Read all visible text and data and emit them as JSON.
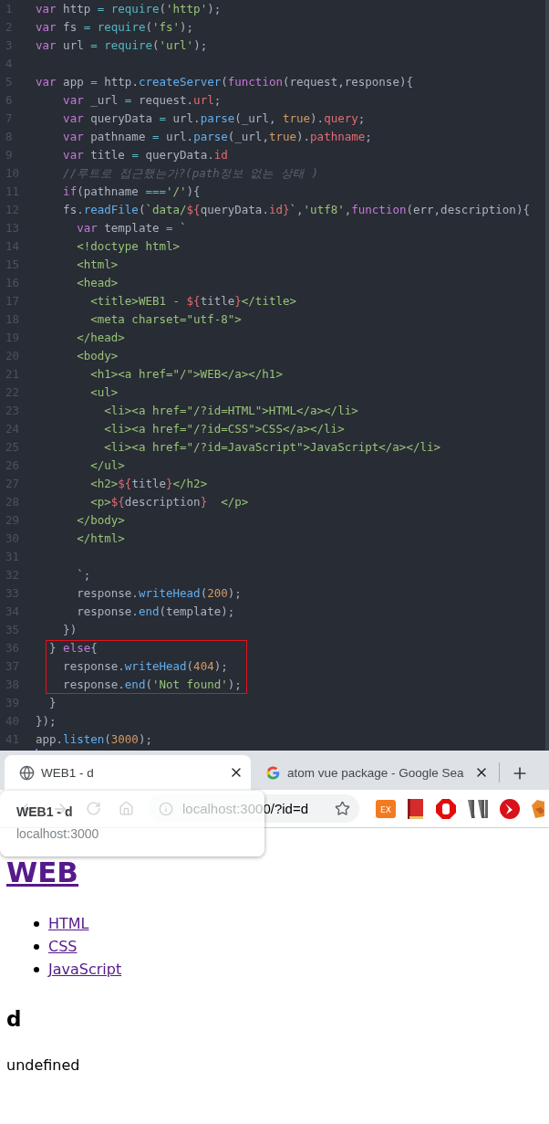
{
  "editor": {
    "lines": [
      {
        "number": "1",
        "boxed": false,
        "tokens": [
          {
            "kind": "k",
            "text": "var"
          },
          {
            "kind": "t",
            "text": " http "
          },
          {
            "kind": "o",
            "text": "= "
          },
          {
            "kind": "b",
            "text": "require"
          },
          {
            "kind": "t",
            "text": "("
          },
          {
            "kind": "s",
            "text": "'http'"
          },
          {
            "kind": "t",
            "text": ");"
          }
        ]
      },
      {
        "number": "2",
        "boxed": false,
        "tokens": [
          {
            "kind": "k",
            "text": "var"
          },
          {
            "kind": "t",
            "text": " fs "
          },
          {
            "kind": "o",
            "text": "= "
          },
          {
            "kind": "b",
            "text": "require"
          },
          {
            "kind": "t",
            "text": "("
          },
          {
            "kind": "s",
            "text": "'fs'"
          },
          {
            "kind": "t",
            "text": ");"
          }
        ]
      },
      {
        "number": "3",
        "boxed": false,
        "tokens": [
          {
            "kind": "k",
            "text": "var"
          },
          {
            "kind": "t",
            "text": " url "
          },
          {
            "kind": "o",
            "text": "= "
          },
          {
            "kind": "b",
            "text": "require"
          },
          {
            "kind": "t",
            "text": "("
          },
          {
            "kind": "s",
            "text": "'url'"
          },
          {
            "kind": "t",
            "text": ");"
          }
        ]
      },
      {
        "number": "4",
        "boxed": false
      },
      {
        "number": "5",
        "boxed": false,
        "tokens": [
          {
            "kind": "k",
            "text": "var"
          },
          {
            "kind": "t",
            "text": " app "
          },
          {
            "kind": "o",
            "text": "="
          },
          {
            "kind": "t",
            "text": " http."
          },
          {
            "kind": "f",
            "text": "createServer"
          },
          {
            "kind": "t",
            "text": "("
          },
          {
            "kind": "k",
            "text": "function"
          },
          {
            "kind": "t",
            "text": "(request,response){"
          }
        ]
      },
      {
        "number": "6",
        "boxed": false,
        "tokens": [
          {
            "kind": "k",
            "text": "    var"
          },
          {
            "kind": "t",
            "text": " _url "
          },
          {
            "kind": "o",
            "text": "="
          },
          {
            "kind": "t",
            "text": " request."
          },
          {
            "kind": "p",
            "text": "url"
          },
          {
            "kind": "t",
            "text": ";"
          }
        ]
      },
      {
        "number": "7",
        "boxed": false,
        "tokens": [
          {
            "kind": "k",
            "text": "    var"
          },
          {
            "kind": "t",
            "text": " queryData "
          },
          {
            "kind": "o",
            "text": "="
          },
          {
            "kind": "t",
            "text": " url."
          },
          {
            "kind": "f",
            "text": "parse"
          },
          {
            "kind": "t",
            "text": "(_url, "
          },
          {
            "kind": "n",
            "text": "true"
          },
          {
            "kind": "t",
            "text": ")."
          },
          {
            "kind": "p",
            "text": "query"
          },
          {
            "kind": "t",
            "text": ";"
          }
        ]
      },
      {
        "number": "8",
        "boxed": false,
        "tokens": [
          {
            "kind": "k",
            "text": "    var"
          },
          {
            "kind": "t",
            "text": " pathname "
          },
          {
            "kind": "o",
            "text": "="
          },
          {
            "kind": "t",
            "text": " url."
          },
          {
            "kind": "f",
            "text": "parse"
          },
          {
            "kind": "t",
            "text": "(_url,"
          },
          {
            "kind": "n",
            "text": "true"
          },
          {
            "kind": "t",
            "text": ")."
          },
          {
            "kind": "p",
            "text": "pathname"
          },
          {
            "kind": "t",
            "text": ";"
          }
        ]
      },
      {
        "number": "9",
        "boxed": false,
        "tokens": [
          {
            "kind": "k",
            "text": "    var"
          },
          {
            "kind": "t",
            "text": " title "
          },
          {
            "kind": "o",
            "text": "="
          },
          {
            "kind": "t",
            "text": " queryData."
          },
          {
            "kind": "p",
            "text": "id"
          }
        ]
      },
      {
        "number": "10",
        "boxed": false,
        "tokens": [
          {
            "kind": "c",
            "text": "    //루트로 접근했는가?(path정보 없는 상태 )"
          }
        ]
      },
      {
        "number": "11",
        "boxed": false,
        "tokens": [
          {
            "kind": "k",
            "text": "    if"
          },
          {
            "kind": "t",
            "text": "(pathname "
          },
          {
            "kind": "o",
            "text": "==="
          },
          {
            "kind": "s",
            "text": "'/'"
          },
          {
            "kind": "t",
            "text": "){"
          }
        ]
      },
      {
        "number": "12",
        "boxed": false,
        "tokens": [
          {
            "kind": "t",
            "text": "    fs."
          },
          {
            "kind": "f",
            "text": "readFile"
          },
          {
            "kind": "t",
            "text": "("
          },
          {
            "kind": "s",
            "text": "`data/"
          },
          {
            "kind": "p",
            "text": "${"
          },
          {
            "kind": "t",
            "text": "queryData."
          },
          {
            "kind": "p",
            "text": "id"
          },
          {
            "kind": "p",
            "text": "}"
          },
          {
            "kind": "s",
            "text": "`"
          },
          {
            "kind": "t",
            "text": ","
          },
          {
            "kind": "s",
            "text": "'utf8'"
          },
          {
            "kind": "t",
            "text": ","
          },
          {
            "kind": "k",
            "text": "function"
          },
          {
            "kind": "t",
            "text": "(err,description){"
          }
        ]
      },
      {
        "number": "13",
        "boxed": false,
        "tokens": [
          {
            "kind": "k",
            "text": "      var"
          },
          {
            "kind": "t",
            "text": " template "
          },
          {
            "kind": "o",
            "text": "="
          },
          {
            "kind": "s",
            "text": " `"
          }
        ]
      },
      {
        "number": "14",
        "boxed": false,
        "tokens": [
          {
            "kind": "s",
            "text": "      <!doctype html>"
          }
        ]
      },
      {
        "number": "15",
        "boxed": false,
        "tokens": [
          {
            "kind": "s",
            "text": "      <html>"
          }
        ]
      },
      {
        "number": "16",
        "boxed": false,
        "tokens": [
          {
            "kind": "s",
            "text": "      <head>"
          }
        ]
      },
      {
        "number": "17",
        "boxed": false,
        "tokens": [
          {
            "kind": "s",
            "text": "        <title>WEB1 - "
          },
          {
            "kind": "p",
            "text": "${"
          },
          {
            "kind": "t",
            "text": "title"
          },
          {
            "kind": "p",
            "text": "}"
          },
          {
            "kind": "s",
            "text": "</title>"
          }
        ]
      },
      {
        "number": "18",
        "boxed": false,
        "tokens": [
          {
            "kind": "s",
            "text": "        <meta charset=\"utf-8\">"
          }
        ]
      },
      {
        "number": "19",
        "boxed": false,
        "tokens": [
          {
            "kind": "s",
            "text": "      </head>"
          }
        ]
      },
      {
        "number": "20",
        "boxed": false,
        "tokens": [
          {
            "kind": "s",
            "text": "      <body>"
          }
        ]
      },
      {
        "number": "21",
        "boxed": false,
        "tokens": [
          {
            "kind": "s",
            "text": "        <h1><a href=\"/\">WEB</a></h1>"
          }
        ]
      },
      {
        "number": "22",
        "boxed": false,
        "tokens": [
          {
            "kind": "s",
            "text": "        <ul>"
          }
        ]
      },
      {
        "number": "23",
        "boxed": false,
        "tokens": [
          {
            "kind": "s",
            "text": "          <li><a href=\"/?id=HTML\">HTML</a></li>"
          }
        ]
      },
      {
        "number": "24",
        "boxed": false,
        "tokens": [
          {
            "kind": "s",
            "text": "          <li><a href=\"/?id=CSS\">CSS</a></li>"
          }
        ]
      },
      {
        "number": "25",
        "boxed": false,
        "tokens": [
          {
            "kind": "s",
            "text": "          <li><a href=\"/?id=JavaScript\">JavaScript</a></li>"
          }
        ]
      },
      {
        "number": "26",
        "boxed": false,
        "tokens": [
          {
            "kind": "s",
            "text": "        </ul>"
          }
        ]
      },
      {
        "number": "27",
        "boxed": false,
        "tokens": [
          {
            "kind": "s",
            "text": "        <h2>"
          },
          {
            "kind": "p",
            "text": "${"
          },
          {
            "kind": "t",
            "text": "title"
          },
          {
            "kind": "p",
            "text": "}"
          },
          {
            "kind": "s",
            "text": "</h2>"
          }
        ]
      },
      {
        "number": "28",
        "boxed": false,
        "tokens": [
          {
            "kind": "s",
            "text": "        <p>"
          },
          {
            "kind": "p",
            "text": "${"
          },
          {
            "kind": "t",
            "text": "description"
          },
          {
            "kind": "p",
            "text": "}"
          },
          {
            "kind": "s",
            "text": "  </p>"
          }
        ]
      },
      {
        "number": "29",
        "boxed": false,
        "tokens": [
          {
            "kind": "s",
            "text": "      </body>"
          }
        ]
      },
      {
        "number": "30",
        "boxed": false,
        "tokens": [
          {
            "kind": "s",
            "text": "      </html>"
          }
        ]
      },
      {
        "number": "31",
        "boxed": false
      },
      {
        "number": "32",
        "boxed": false,
        "tokens": [
          {
            "kind": "s",
            "text": "      `"
          },
          {
            "kind": "t",
            "text": ";"
          }
        ]
      },
      {
        "number": "33",
        "boxed": false,
        "tokens": [
          {
            "kind": "t",
            "text": "      response."
          },
          {
            "kind": "f",
            "text": "writeHead"
          },
          {
            "kind": "t",
            "text": "("
          },
          {
            "kind": "n",
            "text": "200"
          },
          {
            "kind": "t",
            "text": ");"
          }
        ]
      },
      {
        "number": "34",
        "boxed": false,
        "tokens": [
          {
            "kind": "t",
            "text": "      response."
          },
          {
            "kind": "f",
            "text": "end"
          },
          {
            "kind": "t",
            "text": "(template);"
          }
        ]
      },
      {
        "number": "35",
        "boxed": false,
        "tokens": [
          {
            "kind": "t",
            "text": "    })"
          }
        ]
      },
      {
        "number": "36",
        "boxed": true,
        "tokens": [
          {
            "kind": "t",
            "text": "  } "
          },
          {
            "kind": "k",
            "text": "else"
          },
          {
            "kind": "t",
            "text": "{"
          }
        ]
      },
      {
        "number": "37",
        "boxed": true,
        "tokens": [
          {
            "kind": "t",
            "text": "    response."
          },
          {
            "kind": "f",
            "text": "writeHead"
          },
          {
            "kind": "t",
            "text": "("
          },
          {
            "kind": "n",
            "text": "404"
          },
          {
            "kind": "t",
            "text": ");"
          }
        ]
      },
      {
        "number": "38",
        "boxed": true,
        "tokens": [
          {
            "kind": "t",
            "text": "    response."
          },
          {
            "kind": "f",
            "text": "end"
          },
          {
            "kind": "t",
            "text": "("
          },
          {
            "kind": "s",
            "text": "'Not found'"
          },
          {
            "kind": "t",
            "text": ");"
          }
        ]
      },
      {
        "number": "39",
        "boxed": false,
        "tokens": [
          {
            "kind": "t",
            "text": "  }"
          }
        ]
      },
      {
        "number": "40",
        "boxed": false,
        "tokens": [
          {
            "kind": "t",
            "text": "});"
          }
        ]
      },
      {
        "number": "41",
        "boxed": false,
        "tokens": [
          {
            "kind": "t",
            "text": "app."
          },
          {
            "kind": "f",
            "text": "listen"
          },
          {
            "kind": "t",
            "text": "("
          },
          {
            "kind": "n",
            "text": "3000"
          },
          {
            "kind": "t",
            "text": ");"
          }
        ]
      }
    ]
  },
  "browser": {
    "tabs": [
      {
        "title": "WEB1 - d",
        "selected": true,
        "kind": "globe"
      },
      {
        "title": "atom vue package - Google Sea",
        "selected": false,
        "kind": "google"
      }
    ],
    "address": {
      "value": "localhost:3000/?id=d"
    },
    "hover_card": {
      "title": "WEB1 - d",
      "url": "localhost:3000"
    },
    "extensions": [
      {
        "kind": "ex",
        "label": "EX"
      },
      {
        "kind": "book"
      },
      {
        "kind": "stop"
      },
      {
        "kind": "bars"
      },
      {
        "kind": "circle"
      },
      {
        "kind": "fox"
      }
    ]
  },
  "page": {
    "heading": "WEB",
    "links": [
      "HTML",
      "CSS",
      "JavaScript"
    ],
    "title": "d",
    "description": "undefined"
  }
}
